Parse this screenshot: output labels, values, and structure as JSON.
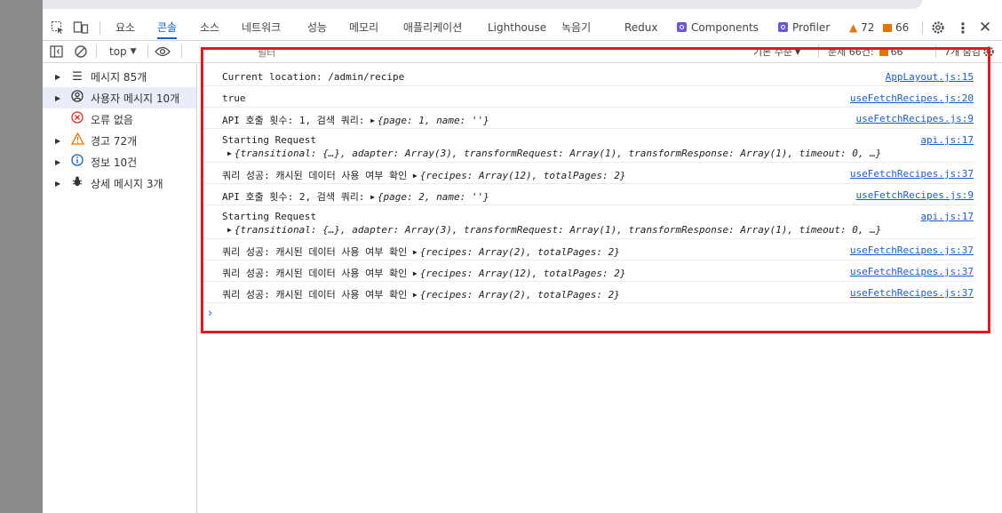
{
  "tabs": {
    "items": [
      "요소",
      "콘솔",
      "소스",
      "네트워크",
      "성능",
      "메모리",
      "애플리케이션",
      "Lighthouse",
      "녹음기",
      "Redux"
    ],
    "components": "Components",
    "profiler": "Profiler",
    "warning_count": "72",
    "issue_count": "66"
  },
  "toolbar": {
    "context": "top",
    "filter_placeholder": "필터",
    "default_levels": "기본 수준",
    "issues_text": "문제 66건:",
    "issues_count": "66",
    "hidden_text": "7개 숨김"
  },
  "sidebar": {
    "items": [
      {
        "label": "메시지 85개",
        "icon": "list-icon"
      },
      {
        "label": "사용자 메시지 10개",
        "icon": "user-icon"
      },
      {
        "label": "오류 없음",
        "icon": "error-icon"
      },
      {
        "label": "경고 72개",
        "icon": "warning-icon"
      },
      {
        "label": "정보 10건",
        "icon": "info-icon"
      },
      {
        "label": "상세 메시지 3개",
        "icon": "bug-icon"
      }
    ]
  },
  "console": {
    "rows": [
      {
        "text": "Current location: /admin/recipe",
        "source": "AppLayout.js:15"
      },
      {
        "text": "true",
        "source": "useFetchRecipes.js:20"
      },
      {
        "text": "API 호출 횟수: 1, 검색 쿼리: ",
        "obj": "{page: 1, name: ''}",
        "source": "useFetchRecipes.js:9"
      },
      {
        "text": "Starting Request",
        "sub": "{transitional: {…}, adapter: Array(3), transformRequest: Array(1), transformResponse: Array(1), timeout: 0, …}",
        "source": "api.js:17"
      },
      {
        "text": "쿼리 성공: 캐시된 데이터 사용 여부 확인 ",
        "obj": "{recipes: Array(12), totalPages: 2}",
        "source": "useFetchRecipes.js:37"
      },
      {
        "text": "API 호출 횟수: 2, 검색 쿼리: ",
        "obj": "{page: 2, name: ''}",
        "source": "useFetchRecipes.js:9"
      },
      {
        "text": "Starting Request",
        "sub": "{transitional: {…}, adapter: Array(3), transformRequest: Array(1), transformResponse: Array(1), timeout: 0, …}",
        "source": "api.js:17"
      },
      {
        "text": "쿼리 성공: 캐시된 데이터 사용 여부 확인 ",
        "obj": "{recipes: Array(2), totalPages: 2}",
        "source": "useFetchRecipes.js:37"
      },
      {
        "text": "쿼리 성공: 캐시된 데이터 사용 여부 확인 ",
        "obj": "{recipes: Array(12), totalPages: 2}",
        "source": "useFetchRecipes.js:37"
      },
      {
        "text": "쿼리 성공: 캐시된 데이터 사용 여부 확인 ",
        "obj": "{recipes: Array(2), totalPages: 2}",
        "source": "useFetchRecipes.js:37"
      }
    ],
    "prompt": "›"
  },
  "colors": {
    "accent": "#1a5fd1",
    "highlight_border": "#e0191e",
    "warning": "#e37400"
  }
}
